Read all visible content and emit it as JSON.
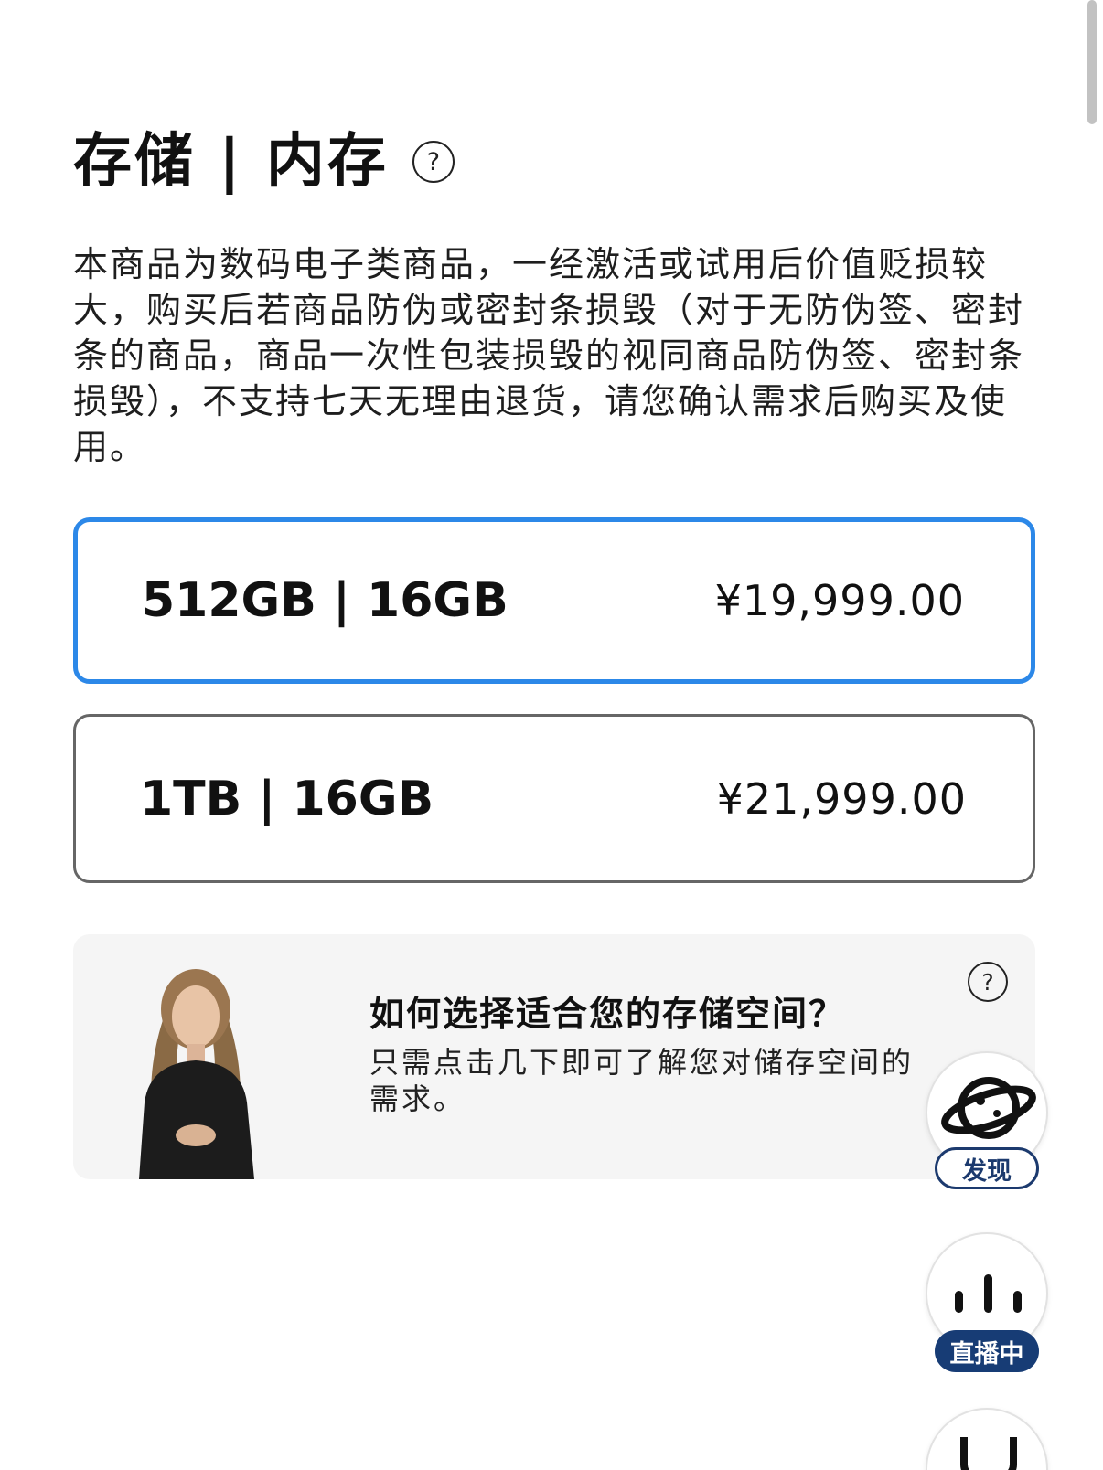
{
  "section": {
    "title": "存储 | 内存",
    "help_glyph": "?",
    "notice": "本商品为数码电子类商品，一经激活或试用后价值贬损较大，购买后若商品防伪或密封条损毁（对于无防伪签、密封条的商品，商品一次性包装损毁的视同商品防伪签、密封条损毁），不支持七天无理由退货，请您确认需求后购买及使用。"
  },
  "options": [
    {
      "label": "512GB | 16GB",
      "price": "¥19,999.00",
      "selected": true
    },
    {
      "label": "1TB | 16GB",
      "price": "¥21,999.00",
      "selected": false
    }
  ],
  "guide": {
    "title": "如何选择适合您的存储空间？",
    "body": "只需点击几下即可了解您对储存空间的需求。",
    "help_glyph": "?"
  },
  "floating": {
    "discover_label": "发现",
    "live_label": "直播中",
    "discover_icon": "planet-icon",
    "live_icon": "live-bars-icon"
  },
  "colors": {
    "selected_border": "#2c88e8",
    "unselected_border": "#666666",
    "live_pill": "#173c75"
  }
}
